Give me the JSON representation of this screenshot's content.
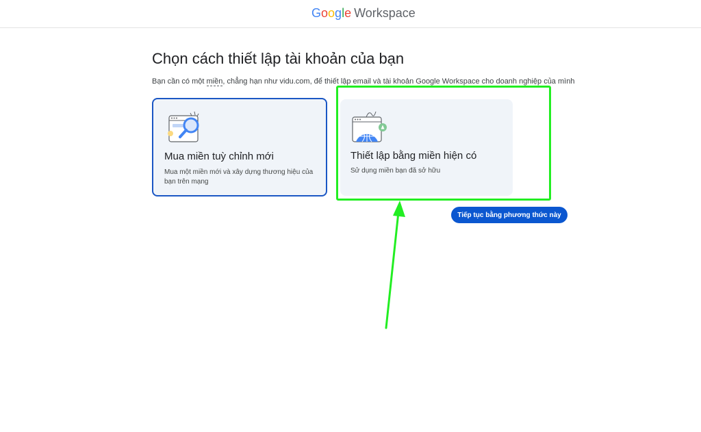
{
  "header": {
    "logo_letters": [
      {
        "char": "G",
        "color": "#4285F4"
      },
      {
        "char": "o",
        "color": "#EA4335"
      },
      {
        "char": "o",
        "color": "#FBBC05"
      },
      {
        "char": "g",
        "color": "#4285F4"
      },
      {
        "char": "l",
        "color": "#34A853"
      },
      {
        "char": "e",
        "color": "#EA4335"
      }
    ],
    "product": "Workspace"
  },
  "main": {
    "title": "Chọn cách thiết lập tài khoản của bạn",
    "subtitle_before": "Bạn cần có một ",
    "subtitle_term": "miền",
    "subtitle_after": ", chẳng hạn như vidu.com, để thiết lập email và tài khoản Google Workspace cho doanh nghiệp của mình"
  },
  "options": [
    {
      "title": "Mua miền tuỳ chỉnh mới",
      "description": "Mua một miền mới và xây dựng thương hiệu của bạn trên mạng",
      "selected": true,
      "icon": "search-domain-icon"
    },
    {
      "title": "Thiết lập bằng miền hiện có",
      "description": "Sử dụng miền bạn đã sở hữu",
      "selected": false,
      "icon": "globe-domain-icon"
    }
  ],
  "continue_button": {
    "label": "Tiếp tục bằng phương thức này"
  },
  "colors": {
    "accent": "#0b57d0",
    "selected_border": "#1a56c4",
    "card_bg": "#f0f4f9",
    "annotation": "#22ee22"
  }
}
